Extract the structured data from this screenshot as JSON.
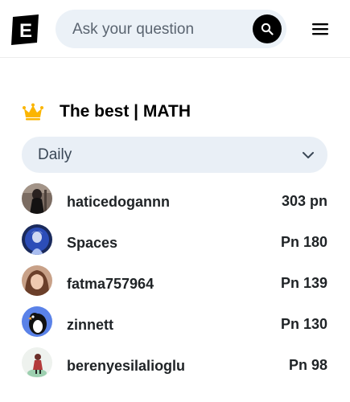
{
  "header": {
    "search_placeholder": "Ask your question",
    "logo_letter": "E",
    "accent_color": "#fbd440"
  },
  "ranking": {
    "title": "The best | MATH",
    "period": "Daily",
    "users": [
      {
        "name": "haticedogannn",
        "points": "303 pn",
        "avatar": "photo-dark"
      },
      {
        "name": "Spaces",
        "points": "Pn 180",
        "avatar": "photo-blue"
      },
      {
        "name": "fatma757964",
        "points": "Pn 139",
        "avatar": "photo-portrait"
      },
      {
        "name": "zinnett",
        "points": "Pn 130",
        "avatar": "penguin"
      },
      {
        "name": "berenyesilalioglu",
        "points": "Pn 98",
        "avatar": "cartoon"
      }
    ]
  }
}
